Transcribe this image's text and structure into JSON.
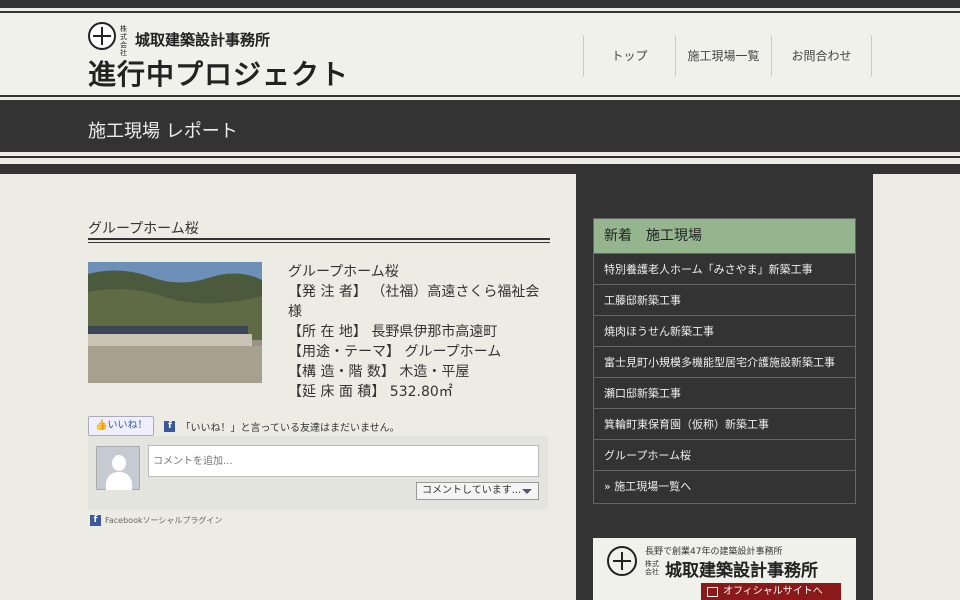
{
  "header": {
    "company_kabu": "株式会社",
    "company_name": "城取建築設計事務所",
    "site_title": "進行中プロジェクト",
    "nav": [
      "トップ",
      "施工現場一覧",
      "お問合わせ"
    ]
  },
  "banner": {
    "title": "施工現場 レポート"
  },
  "post": {
    "title": "グループホーム桜",
    "info": [
      "グループホーム桜",
      "【発 注 者】 （社福）高遠さくら福祉会",
      "様",
      "【所 在 地】 長野県伊那市高遠町",
      "【用途・テーマ】 グループホーム",
      "【構 造・階 数】 木造・平屋",
      "【延 床 面 積】 532.80㎡"
    ]
  },
  "facebook": {
    "like_label": "いいね！",
    "like_text": "「いいね！」と言っている友達はまだいません。",
    "comment_placeholder": "コメントを追加...",
    "post_as": "コメントしています...",
    "plugin_label": "Facebookソーシャルプラグイン"
  },
  "sidebar": {
    "heading": "新着　施工現場",
    "items": [
      "特別養護老人ホーム「みさやま」新築工事",
      "工藤邸新築工事",
      "焼肉ほうせん新築工事",
      "富士見町小規模多機能型居宅介護施設新築工事",
      "瀬口邸新築工事",
      "箕輪町東保育園（仮称）新築工事",
      "グループホーム桜",
      "» 施工現場一覧へ"
    ],
    "ad": {
      "tagline": "長野で創業47年の建築設計事務所",
      "kabu": "株式会社",
      "name": "城取建築設計事務所",
      "button": "オフィシャルサイトへ"
    }
  }
}
